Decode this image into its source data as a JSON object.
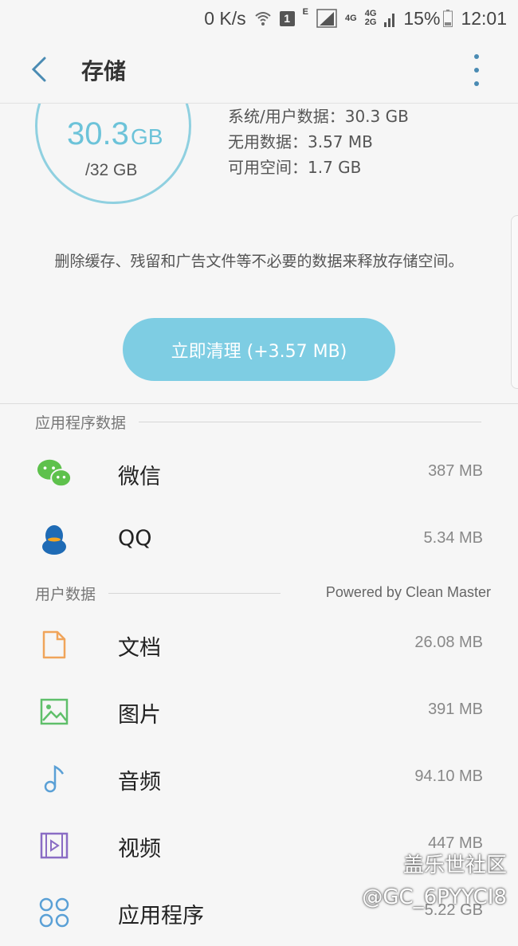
{
  "status_bar": {
    "net_speed": "0 K/s",
    "sim_badge": "1",
    "edge_label": "E",
    "lte1": "4G",
    "lte2_top": "4G",
    "lte2_bottom": "2G",
    "battery": "15%",
    "time": "12:01"
  },
  "header": {
    "title": "存储",
    "back_icon": "back-arrow-icon",
    "more_icon": "more-vert-icon"
  },
  "storage": {
    "used_value": "30.3",
    "used_unit": "GB",
    "total": "/32 GB",
    "system_user_data": "系统/用户数据：30.3 GB",
    "junk_data": "无用数据：3.57 MB",
    "available": "可用空间：1.7 GB",
    "used_fraction": 0.947,
    "description": "删除缓存、残留和广告文件等不必要的数据来释放存储空间。",
    "clean_button": "立即清理 (+3.57 MB)"
  },
  "app_data": {
    "header": "应用程序数据",
    "items": [
      {
        "name": "微信",
        "size": "387 MB",
        "icon": "wechat-icon"
      },
      {
        "name": "QQ",
        "size": "5.34 MB",
        "icon": "qq-penguin-icon"
      }
    ]
  },
  "user_data": {
    "header": "用户数据",
    "powered_by": "Powered by Clean Master",
    "items": [
      {
        "name": "文档",
        "size": "26.08 MB",
        "icon": "document-icon"
      },
      {
        "name": "图片",
        "size": "391 MB",
        "icon": "image-icon"
      },
      {
        "name": "音频",
        "size": "94.10 MB",
        "icon": "music-note-icon"
      },
      {
        "name": "视频",
        "size": "447 MB",
        "icon": "video-icon"
      },
      {
        "name": "应用程序",
        "size": "5.22 GB",
        "icon": "apps-grid-icon"
      }
    ]
  },
  "watermark": {
    "line1": "盖乐世社区",
    "line2": "@GC_6PYYCI8"
  },
  "colors": {
    "accent": "#7ecde3",
    "ring": "#8fd0e0",
    "used_text": "#6cc3d9",
    "wechat_green": "#5ec14c",
    "qq_blue": "#1f6bb5"
  }
}
